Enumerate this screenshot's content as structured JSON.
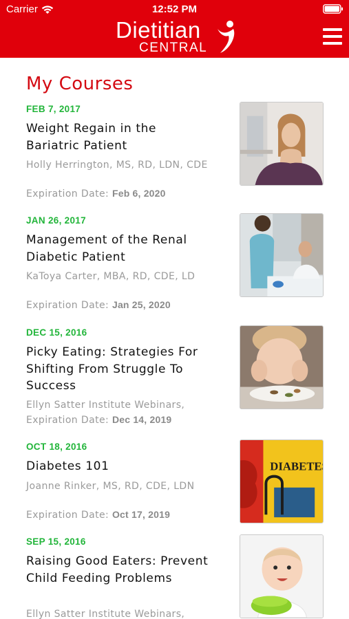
{
  "status_bar": {
    "carrier": "Carrier",
    "time": "12:52 PM"
  },
  "header": {
    "logo_main": "Dietitian",
    "logo_sub": "CENTRAL",
    "brand_color": "#e0000b"
  },
  "page": {
    "title": "My Courses",
    "title_color": "#d40a12",
    "date_color": "#22b53a"
  },
  "courses": [
    {
      "date": "FEB 7, 2017",
      "title": "Weight Regain in the Bariatric Patient",
      "author": "Holly Herrington, MS, RD, LDN, CDE",
      "expiration_label": "Expiration Date:",
      "expiration_date": "Feb 6, 2020",
      "image": "woman-thinking-photo"
    },
    {
      "date": "JAN 26, 2017",
      "title": "Management of the Renal Diabetic Patient",
      "author": "KaToya Carter, MBA, RD, CDE, LD",
      "expiration_label": "Expiration Date:",
      "expiration_date": "Jan 25, 2020",
      "image": "nurse-patient-photo"
    },
    {
      "date": "DEC 15, 2016",
      "title": "Picky Eating: Strategies For Shifting From Struggle To Success",
      "author": "Ellyn Satter Institute Webinars,",
      "expiration_label": "Expiration Date:",
      "expiration_date": "Dec 14, 2019",
      "image": "child-with-plate-photo"
    },
    {
      "date": "OCT 18, 2016",
      "title": "Diabetes 101",
      "author": "Joanne Rinker, MS, RD, CDE, LDN",
      "expiration_label": "Expiration Date:",
      "expiration_date": "Oct 17, 2019",
      "image": "diabetes-graphic",
      "image_text": "DIABETES"
    },
    {
      "date": "SEP 15, 2016",
      "title": "Raising Good Eaters: Prevent Child Feeding Problems",
      "author": "Ellyn Satter Institute Webinars,",
      "expiration_label": "",
      "expiration_date": "",
      "image": "baby-with-bowl-photo"
    }
  ]
}
